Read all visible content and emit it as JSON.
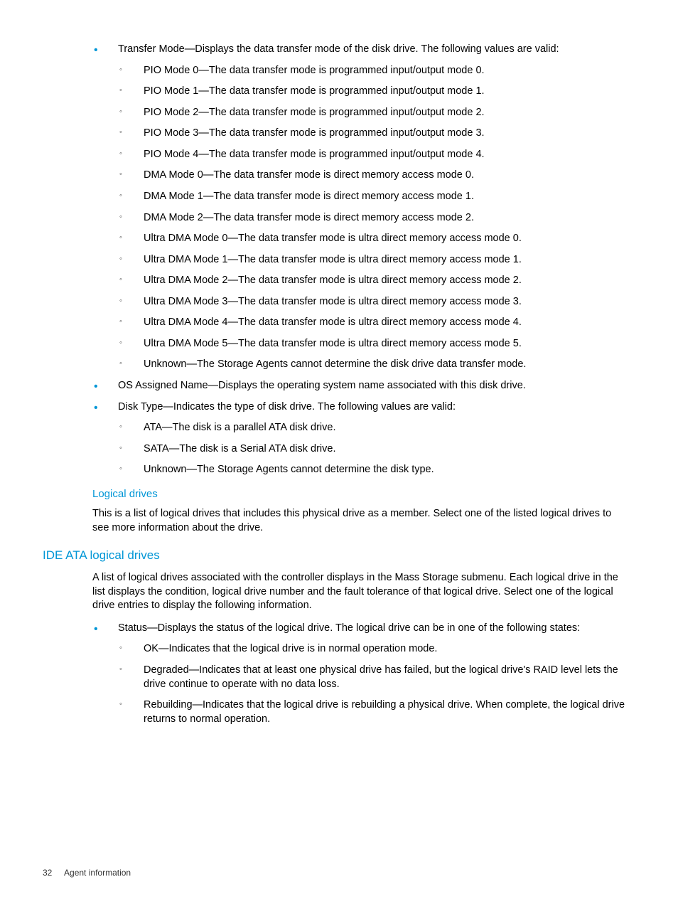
{
  "content": {
    "transferMode": {
      "intro": "Transfer Mode—Displays the data transfer mode of the disk drive. The following values are valid:",
      "items": [
        "PIO Mode 0—The data transfer mode is programmed input/output mode 0.",
        "PIO Mode 1—The data transfer mode is programmed input/output mode 1.",
        "PIO Mode 2—The data transfer mode is programmed input/output mode 2.",
        "PIO Mode 3—The data transfer mode is programmed input/output mode 3.",
        "PIO Mode 4—The data transfer mode is programmed input/output mode 4.",
        "DMA Mode 0—The data transfer mode is direct memory access mode 0.",
        "DMA Mode 1—The data transfer mode is direct memory access mode 1.",
        "DMA Mode 2—The data transfer mode is direct memory access mode 2.",
        "Ultra DMA Mode 0—The data transfer mode is ultra direct memory access mode 0.",
        "Ultra DMA Mode 1—The data transfer mode is ultra direct memory access mode 1.",
        "Ultra DMA Mode 2—The data transfer mode is ultra direct memory access mode 2.",
        "Ultra DMA Mode 3—The data transfer mode is ultra direct memory access mode 3.",
        "Ultra DMA Mode 4—The data transfer mode is ultra direct memory access mode 4.",
        "Ultra DMA Mode 5—The data transfer mode is ultra direct memory access mode 5.",
        "Unknown—The Storage Agents cannot determine the disk drive data transfer mode."
      ]
    },
    "osAssignedName": "OS Assigned Name—Displays the operating system name associated with this disk drive.",
    "diskType": {
      "intro": "Disk Type—Indicates the type of disk drive. The following values are valid:",
      "items": [
        "ATA—The disk is a parallel ATA disk drive.",
        "SATA—The disk is a Serial ATA disk drive.",
        "Unknown—The Storage Agents cannot determine the disk type."
      ]
    },
    "logicalDrives": {
      "heading": "Logical drives",
      "para": "This is a list of logical drives that includes this physical drive as a member. Select one of the listed logical drives to see more information about the drive."
    },
    "ideAta": {
      "heading": "IDE ATA logical drives",
      "para": "A list of logical drives associated with the controller displays in the Mass Storage submenu. Each logical drive in the list displays the condition, logical drive number and the fault tolerance of that logical drive. Select one of the logical drive entries to display the following information.",
      "status": {
        "intro": "Status—Displays the status of the logical drive. The logical drive can be in one of the following states:",
        "items": [
          "OK—Indicates that the logical drive is in normal operation mode.",
          "Degraded—Indicates that at least one physical drive has failed, but the logical drive's RAID level lets the drive continue to operate with no data loss.",
          "Rebuilding—Indicates that the logical drive is rebuilding a physical drive. When complete, the logical drive returns to normal operation."
        ]
      }
    }
  },
  "footer": {
    "pageNumber": "32",
    "section": "Agent information"
  }
}
